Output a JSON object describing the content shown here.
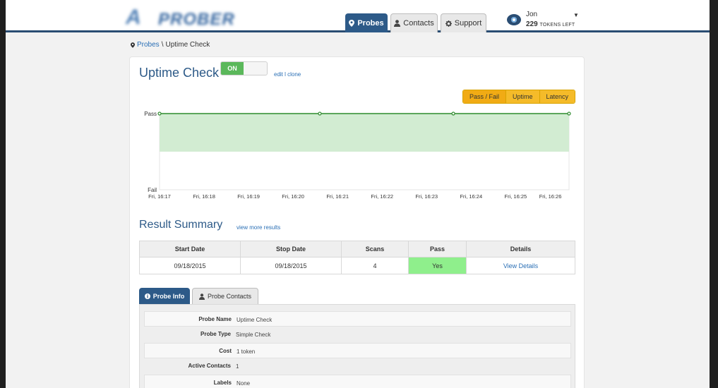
{
  "header": {
    "logo_mark": "A",
    "logo_word": "PROBER",
    "tabs": [
      {
        "label": "Probes",
        "icon": "map-pin-icon",
        "active": true
      },
      {
        "label": "Contacts",
        "icon": "user-icon",
        "active": false
      },
      {
        "label": "Support",
        "icon": "gear-icon",
        "active": false
      }
    ],
    "user": {
      "name": "Jon",
      "tokens": "229",
      "tokens_label": "TOKENS LEFT"
    }
  },
  "breadcrumb": {
    "link": "Probes",
    "separator": "\\",
    "current": "Uptime Check"
  },
  "probe": {
    "title": "Uptime Check",
    "toggle_label": "ON",
    "edit_clone": "edit l clone"
  },
  "chart_controls": [
    "Pass / Fail",
    "Uptime",
    "Latency"
  ],
  "chart_data": {
    "type": "area",
    "y_categories": [
      "Fail",
      "Pass"
    ],
    "ylim": [
      0,
      1
    ],
    "x_ticks": [
      "Fri, 16:17",
      "Fri, 16:18",
      "Fri, 16:19",
      "Fri, 16:20",
      "Fri, 16:21",
      "Fri, 16:22",
      "Fri, 16:23",
      "Fri, 16:24",
      "Fri, 16:25",
      "Fri, 16:26"
    ],
    "xlim_minutes": [
      0,
      9.2
    ],
    "points_minutes": [
      0,
      3.6,
      6.6,
      9.6
    ],
    "values": [
      1,
      1,
      1,
      1
    ],
    "line_color": "#2e8b2e",
    "fill_color": "#d2ecd2"
  },
  "result_summary": {
    "title": "Result Summary",
    "link": "view more results",
    "columns": [
      "Start Date",
      "Stop Date",
      "Scans",
      "Pass",
      "Details"
    ],
    "rows": [
      {
        "start": "09/18/2015",
        "stop": "09/18/2015",
        "scans": "4",
        "pass": "Yes",
        "details": "View Details"
      }
    ]
  },
  "probe_tabs": {
    "info": "Probe Info",
    "contacts": "Probe Contacts"
  },
  "probe_info": [
    {
      "key": "Probe Name",
      "value": "Uptime Check"
    },
    {
      "key": "Probe Type",
      "value": "Simple Check"
    },
    {
      "key": "Cost",
      "value": "1 token"
    },
    {
      "key": "Active Contacts",
      "value": "1"
    },
    {
      "key": "Labels",
      "value": "None"
    }
  ],
  "colors": {
    "brand": "#2d5a88",
    "link": "#2a6fb5",
    "pass": "#8fef8c",
    "accent": "#f5bb29",
    "on": "#5bb85b"
  }
}
